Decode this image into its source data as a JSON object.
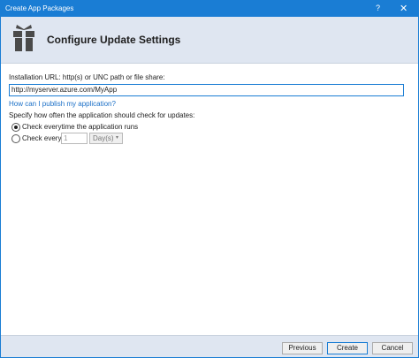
{
  "window": {
    "title": "Create App Packages",
    "help_glyph": "?",
    "close_glyph": "✕"
  },
  "header": {
    "icon": "gift-icon",
    "title": "Configure Update Settings"
  },
  "form": {
    "url_label": "Installation URL: http(s) or UNC path or file share:",
    "url_value": "http://myserver.azure.com/MyApp",
    "publish_link": "How can I publish my application?",
    "frequency_label": "Specify how often the application should check for updates:",
    "options": [
      {
        "label": "Check everytime the application runs",
        "selected": true
      },
      {
        "label": "Check every:",
        "selected": false
      }
    ],
    "interval_value": "1",
    "interval_unit": "Day(s)",
    "interval_unit_chevron": "▾"
  },
  "footer": {
    "previous_label": "Previous",
    "create_label": "Create",
    "cancel_label": "Cancel"
  },
  "colors": {
    "accent": "#1a7dd4",
    "header_bg": "#dfe6f1",
    "link": "#1a6fc7"
  }
}
